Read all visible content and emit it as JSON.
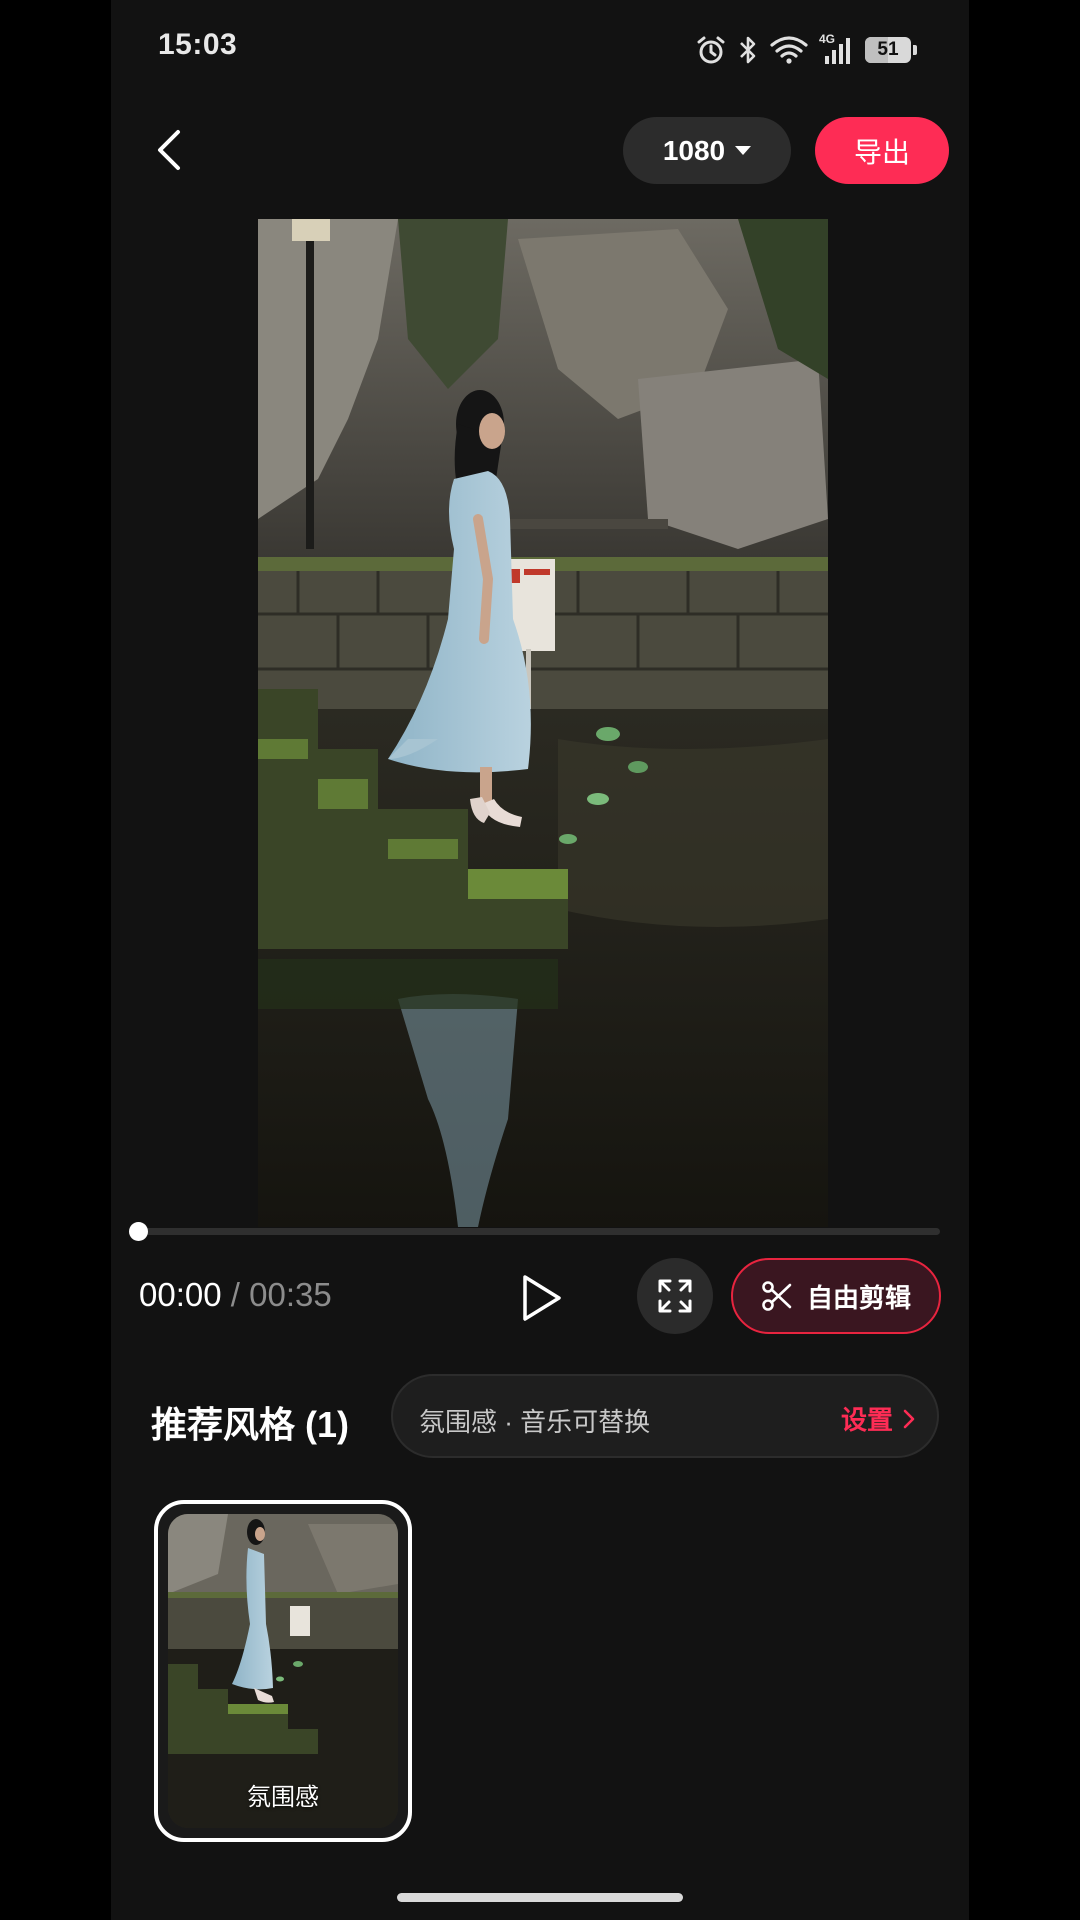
{
  "status_bar": {
    "time": "15:03",
    "network_label": "4G",
    "battery_level": "51",
    "icons": [
      "alarm-icon",
      "bluetooth-icon",
      "wifi-icon",
      "signal-icon",
      "battery-icon"
    ]
  },
  "header": {
    "resolution": "1080",
    "export_label": "导出"
  },
  "player": {
    "current_time": "00:00",
    "separator": " / ",
    "total_time": "00:35",
    "progress": 0,
    "free_edit_label": "自由剪辑"
  },
  "styles": {
    "title": "推荐风格 (1)",
    "bar_text": "氛围感 · 音乐可替换",
    "settings_label": "设置",
    "items": [
      {
        "label": "氛围感",
        "selected": true
      }
    ]
  },
  "colors": {
    "accent": "#fe2c55",
    "background": "#121212",
    "free_edit_border": "#e8243f"
  }
}
